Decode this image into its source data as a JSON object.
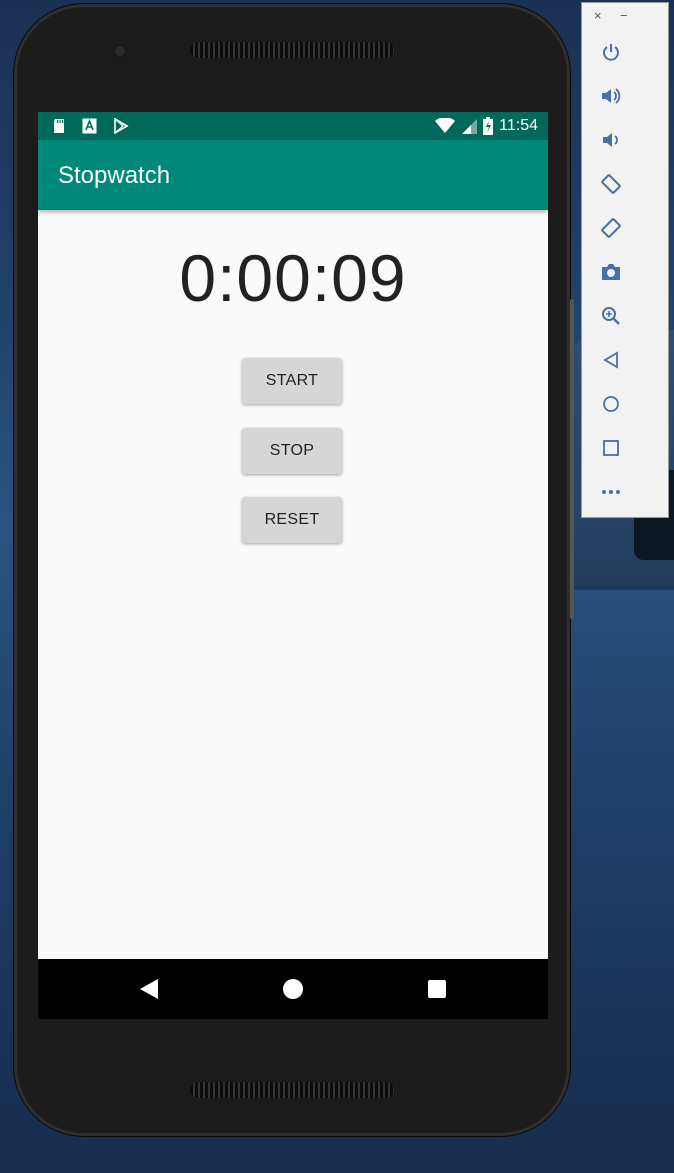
{
  "status_bar": {
    "time": "11:54",
    "icons": [
      "sd-card-icon",
      "app-a-icon",
      "play-store-icon",
      "wifi-icon",
      "signal-icon",
      "battery-charging-icon"
    ]
  },
  "app_bar": {
    "title": "Stopwatch"
  },
  "stopwatch": {
    "time": "0:00:09"
  },
  "buttons": {
    "start": "START",
    "stop": "STOP",
    "reset": "RESET"
  },
  "nav_bar": {
    "icons": [
      "back-icon",
      "home-icon",
      "recents-icon"
    ]
  },
  "emulator_toolbar": {
    "window_controls": {
      "close": "×",
      "minimize": "−"
    },
    "tools": [
      "power-icon",
      "volume-up-icon",
      "volume-down-icon",
      "rotate-left-icon",
      "rotate-right-icon",
      "camera-icon",
      "zoom-icon",
      "back-icon",
      "home-icon",
      "overview-icon",
      "more-icon"
    ]
  },
  "colors": {
    "status_bar": "#00695c",
    "app_bar": "#00897b",
    "screen_bg": "#fafafa",
    "button_bg": "#d6d6d6",
    "toolbar_icon": "#4a6fa5"
  }
}
